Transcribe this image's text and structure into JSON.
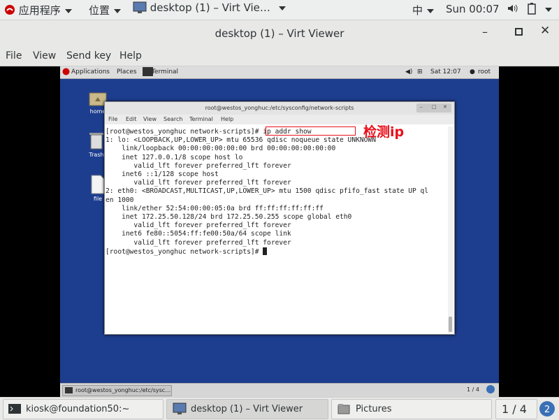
{
  "host_panel": {
    "applications": "应用程序",
    "places": "位置",
    "active_window": "desktop (1) – Virt Vie…",
    "input_method": "中",
    "clock": "Sun 00:07"
  },
  "viewer": {
    "title": "desktop (1) – Virt Viewer",
    "menu": [
      "File",
      "View",
      "Send key",
      "Help"
    ]
  },
  "guest": {
    "top_panel": {
      "applications": "Applications",
      "places": "Places",
      "terminal": "Terminal",
      "clock": "Sat 12:07",
      "user": "root"
    },
    "desktop_icons": [
      "home",
      "Trash",
      "file"
    ],
    "taskbar": {
      "task": "root@westos_yonghuc:/etc/sysc…",
      "pager": "1 / 4"
    },
    "terminal": {
      "title": "root@westos_yonghuc:/etc/sysconfig/network-scripts",
      "menu": [
        "File",
        "Edit",
        "View",
        "Search",
        "Terminal",
        "Help"
      ],
      "lines": [
        "[root@westos_yonghuc network-scripts]# ip addr show",
        "1: lo: <LOOPBACK,UP,LOWER_UP> mtu 65536 qdisc noqueue state UNKNOWN",
        "    link/loopback 00:00:00:00:00:00 brd 00:00:00:00:00:00",
        "    inet 127.0.0.1/8 scope host lo",
        "       valid_lft forever preferred_lft forever",
        "    inet6 ::1/128 scope host",
        "       valid_lft forever preferred_lft forever",
        "2: eth0: <BROADCAST,MULTICAST,UP,LOWER_UP> mtu 1500 qdisc pfifo_fast state UP ql",
        "en 1000",
        "    link/ether 52:54:00:00:05:0a brd ff:ff:ff:ff:ff:ff",
        "    inet 172.25.50.128/24 brd 172.25.50.255 scope global eth0",
        "       valid_lft forever preferred_lft forever",
        "    inet6 fe80::5054:ff:fe00:50a/64 scope link",
        "       valid_lft forever preferred_lft forever"
      ],
      "prompt": "[root@westos_yonghuc network-scripts]# "
    },
    "annotation": "检测ip"
  },
  "host_taskbar": {
    "tasks": [
      "kiosk@foundation50:~",
      "desktop (1) – Virt Viewer",
      "Pictures"
    ],
    "pager": "1 / 4"
  },
  "colors": {
    "guest_desktop": "#1d3d8f",
    "annotation": "#e8101a"
  }
}
